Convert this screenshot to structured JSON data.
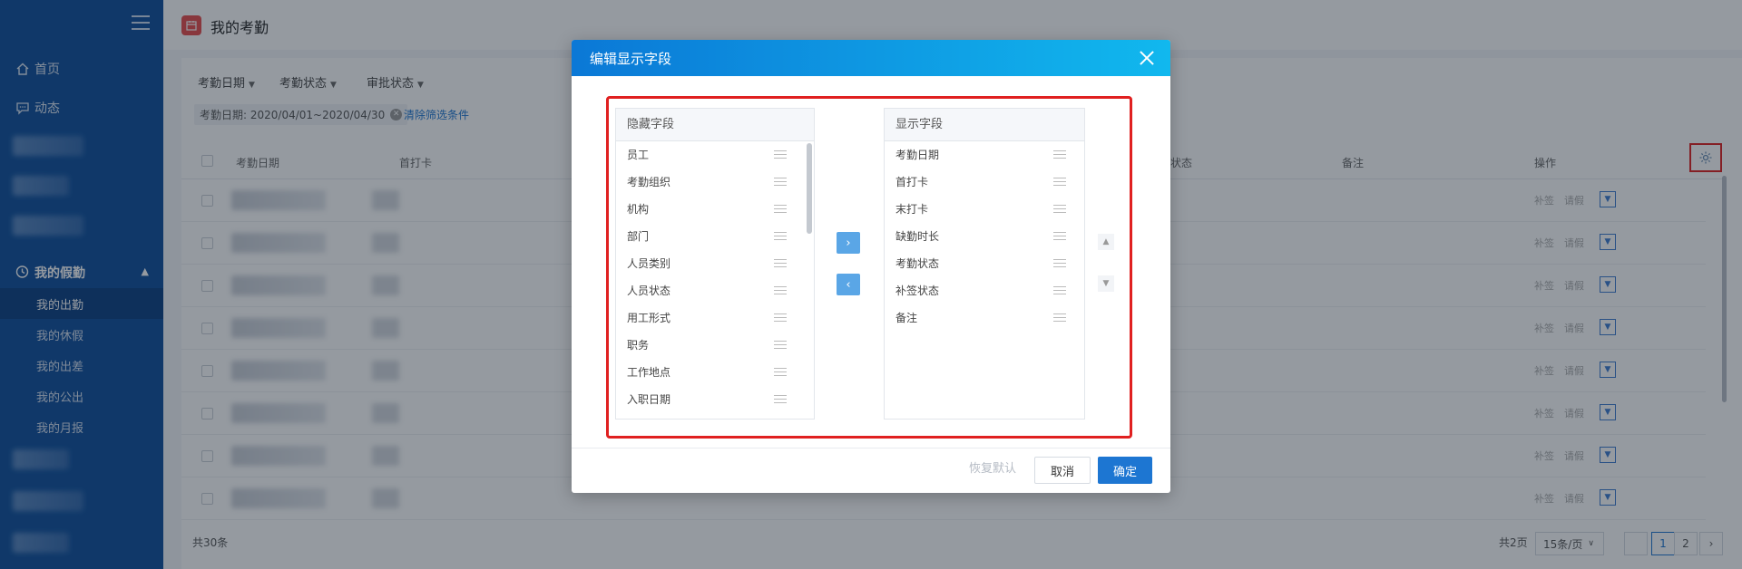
{
  "sidebar": {
    "home": "首页",
    "activity": "动态",
    "group": "我的假勤",
    "sub_items": [
      "我的出勤",
      "我的休假",
      "我的出差",
      "我的公出",
      "我的月报"
    ],
    "active_index": 0
  },
  "header": {
    "title": "我的考勤"
  },
  "filters": {
    "date": "考勤日期",
    "status": "考勤状态",
    "approval": "审批状态",
    "tag": "考勤日期: 2020/04/01~2020/04/30",
    "clear": "清除筛选条件"
  },
  "table": {
    "headers": {
      "date": "考勤日期",
      "first_punch": "首打卡",
      "status": "状态",
      "remark": "备注",
      "ops": "操作"
    },
    "row_actions": [
      "补签",
      "请假"
    ],
    "row_count": 8
  },
  "footer": {
    "total": "共30条",
    "pages": "共2页",
    "page_size": "15条/页",
    "current_page": "1",
    "next_page": "2"
  },
  "modal": {
    "title": "编辑显示字段",
    "hidden_title": "隐藏字段",
    "hidden_fields": [
      "员工",
      "考勤组织",
      "机构",
      "部门",
      "人员类别",
      "人员状态",
      "用工形式",
      "职务",
      "工作地点",
      "入职日期"
    ],
    "shown_title": "显示字段",
    "shown_fields": [
      "考勤日期",
      "首打卡",
      "末打卡",
      "缺勤时长",
      "考勤状态",
      "补签状态",
      "备注"
    ],
    "reset": "恢复默认",
    "cancel": "取消",
    "ok": "确定"
  },
  "colors": {
    "sidebar": "#0d4e9c",
    "accent": "#1d76d2",
    "highlight": "#e02020"
  }
}
